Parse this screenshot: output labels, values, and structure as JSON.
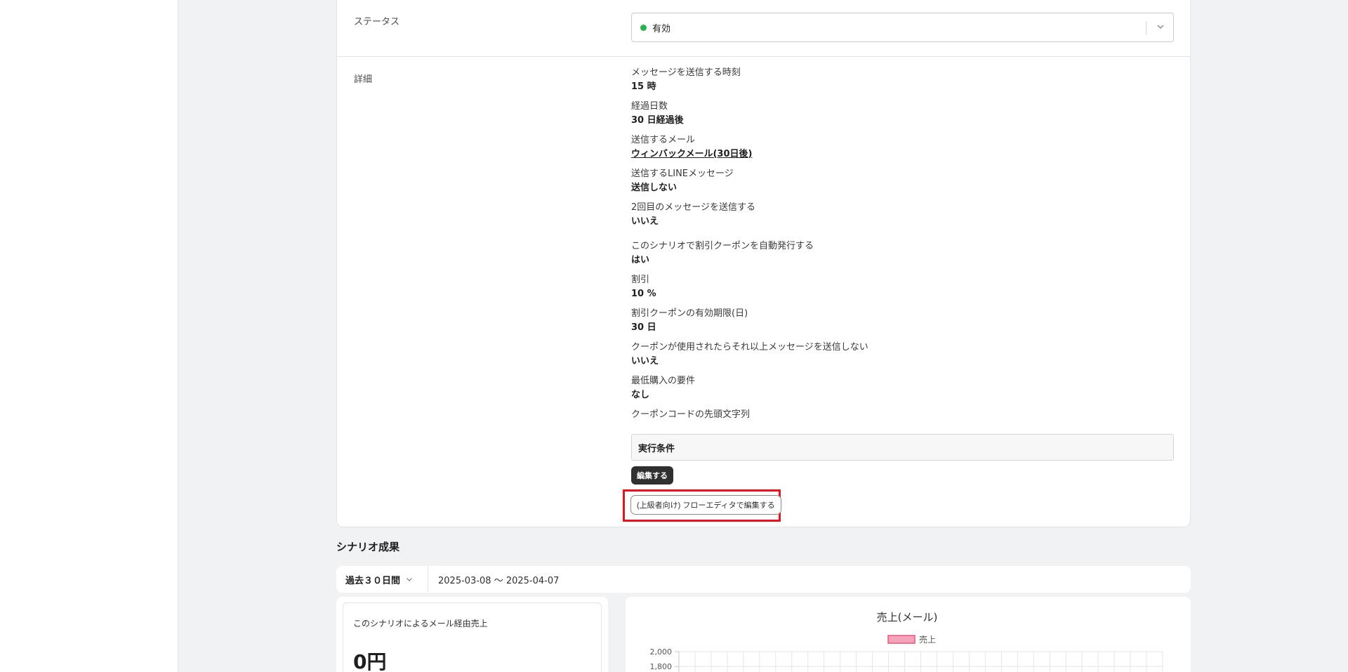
{
  "scenario": {
    "status_label": "ステータス",
    "status_value": "有効",
    "detail_label": "詳細",
    "details": [
      {
        "key": "メッセージを送信する時刻",
        "value": "15 時"
      },
      {
        "key": "経過日数",
        "value": "30 日経過後"
      },
      {
        "key": "送信するメール",
        "value": "ウィンバックメール(30日後)"
      },
      {
        "key": "送信するLINEメッセージ",
        "value": "送信しない"
      },
      {
        "key": "2回目のメッセージを送信する",
        "value": "いいえ"
      },
      {
        "key": "このシナリオで割引クーポンを自動発行する",
        "value": "はい"
      },
      {
        "key": "割引",
        "value": "10 %"
      },
      {
        "key": "割引クーポンの有効期限(日)",
        "value": "30 日"
      },
      {
        "key": "クーポンが使用されたらそれ以上メッセージを送信しない",
        "value": "いいえ"
      },
      {
        "key": "最低購入の要件",
        "value": "なし"
      },
      {
        "key": "クーポンコードの先頭文字列",
        "value": ""
      }
    ],
    "conditions_title": "実行条件",
    "edit_button": "編集する",
    "flow_editor_button": "(上級者向け) フローエディタで編集する"
  },
  "results": {
    "section_title": "シナリオ成果",
    "range_select": "過去３０日間",
    "range_dates": "2025-03-08 〜 2025-04-07",
    "metric_label": "このシナリオによるメール経由売上",
    "metric_value": "0円"
  },
  "colors": {
    "status_active": "#29b14e",
    "highlight": "#e8141b",
    "series_fill": "#f4a3b8",
    "series_stroke": "#e9577f"
  },
  "chart_data": {
    "type": "bar",
    "title": "売上(メール)",
    "series": [
      {
        "name": "売上",
        "values": []
      }
    ],
    "y_ticks": [
      "2,000",
      "1,800"
    ],
    "ylim": [
      0,
      2000
    ],
    "grid": true,
    "legend": "top-center"
  }
}
